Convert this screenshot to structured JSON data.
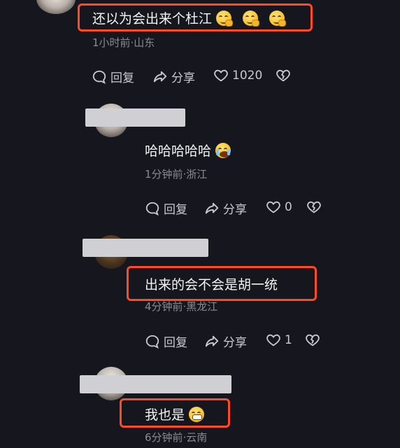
{
  "comments": [
    {
      "text": "还以为会出来个杜江",
      "emojis": [
        "smirk-hand-emoji",
        "smirk-hand-emoji",
        "smirk-hand-emoji"
      ],
      "time_location": "1小时前·山东",
      "reply_label": "回复",
      "share_label": "分享",
      "like_count": "1020"
    },
    {
      "text": "哈哈哈哈哈",
      "emojis": [
        "crying-laughing-emoji"
      ],
      "time_location": "1分钟前·浙江",
      "reply_label": "回复",
      "share_label": "分享",
      "like_count": "0"
    },
    {
      "text": "出来的会不会是胡一统",
      "emojis": [],
      "time_location": "4分钟前·黑龙江",
      "reply_label": "回复",
      "share_label": "分享",
      "like_count": "1"
    },
    {
      "text": "我也是",
      "emojis": [
        "grinning-emoji"
      ],
      "time_location": "6分钟前·云南"
    }
  ],
  "colors": {
    "background": "#16161e",
    "highlight": "#ff4a24",
    "meta_text": "#8a8a93",
    "action_text": "#c9c9cf"
  }
}
